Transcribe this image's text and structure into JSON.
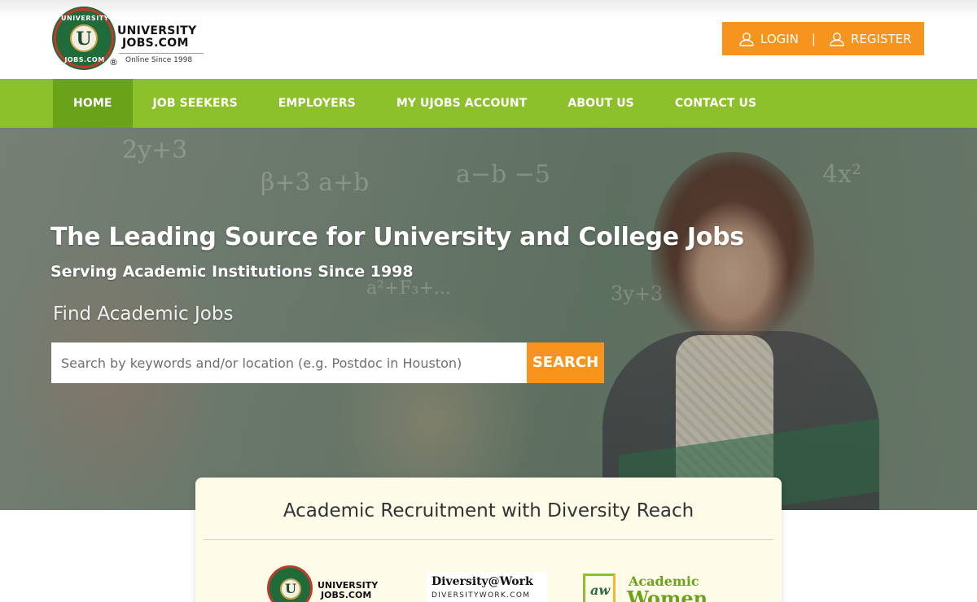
{
  "header": {
    "logo": {
      "arc_top": "UNIVERSITY",
      "arc_bottom": "JOBS.COM",
      "badge_letter": "U",
      "name_line1": "UNIVERSITY",
      "name_line2": "JOBS.COM",
      "registered": "®",
      "tagline": "Online Since 1998"
    },
    "auth": {
      "login_label": "LOGIN",
      "separator": "|",
      "register_label": "REGISTER",
      "icon": "user-icon"
    }
  },
  "nav": {
    "items": [
      {
        "label": "HOME",
        "active": true
      },
      {
        "label": "JOB SEEKERS",
        "active": false
      },
      {
        "label": "EMPLOYERS",
        "active": false
      },
      {
        "label": "MY UJOBS ACCOUNT",
        "active": false
      },
      {
        "label": "ABOUT US",
        "active": false
      },
      {
        "label": "CONTACT US",
        "active": false
      }
    ]
  },
  "hero": {
    "title": "The Leading Source for University and College Jobs",
    "subtitle": "Serving Academic Institutions Since 1998",
    "find_label": "Find Academic Jobs",
    "search": {
      "placeholder": "Search by keywords and/or location (e.g. Postdoc in Houston)",
      "value": "",
      "button_label": "SEARCH"
    }
  },
  "card": {
    "title": "Academic Recruitment with Diversity Reach",
    "partners": [
      {
        "line1": "UNIVERSITY",
        "line2": "JOBS.COM",
        "badge_letter": "U"
      },
      {
        "line1": "Diversity@Work",
        "line2": "DIVERSITYWORK.COM"
      },
      {
        "line1": "Academic",
        "line2": "Women",
        "mark": "aw"
      }
    ]
  },
  "colors": {
    "nav_green": "#8dc12b",
    "nav_active": "#6aa31a",
    "accent_orange": "#f7941d",
    "card_bg": "#fefbe9"
  }
}
